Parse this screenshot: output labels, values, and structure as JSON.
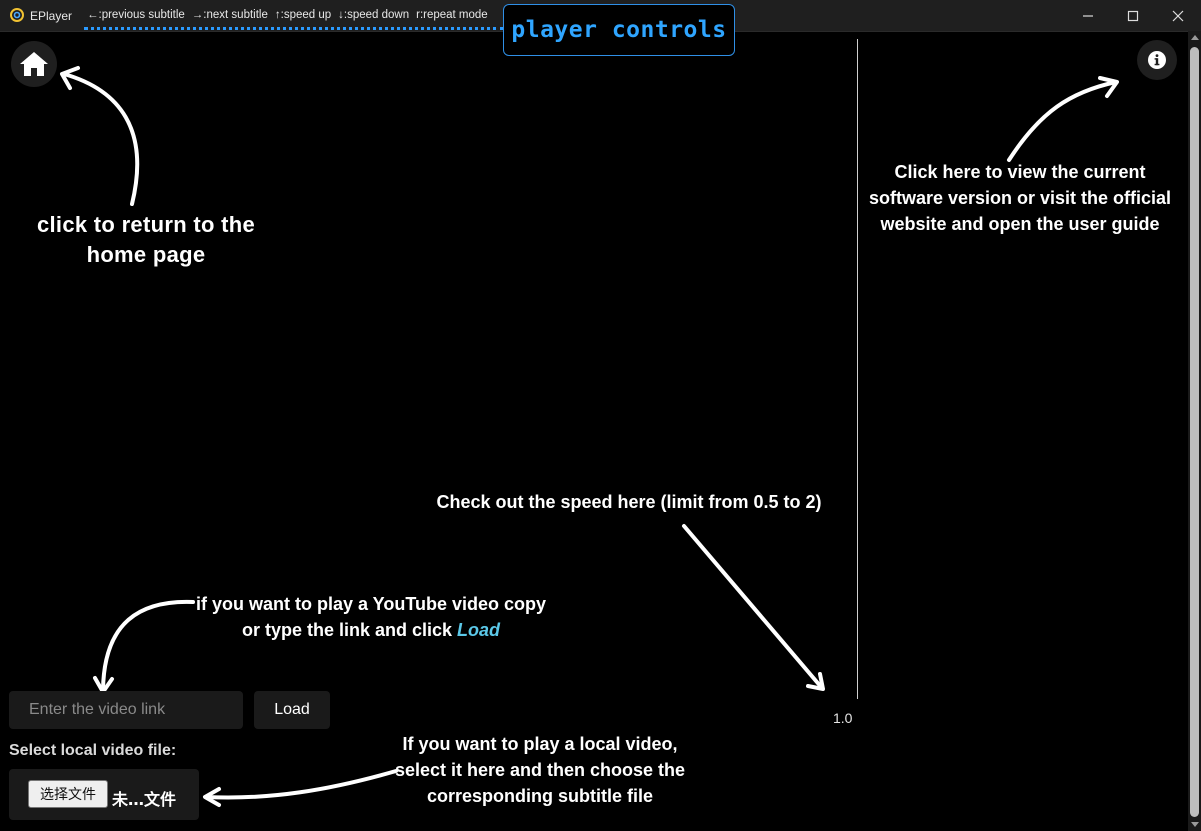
{
  "window": {
    "title": "EPlayer",
    "shortcuts": [
      "←:previous subtitle",
      "→:next subtitle",
      "↑:speed up",
      "↓:speed down",
      "r:repeat mode"
    ],
    "buttons": [
      "minimize-icon",
      "maximize-icon",
      "close-icon"
    ]
  },
  "controls_badge": {
    "label": "player controls",
    "color": "#2fa5ff"
  },
  "home_button": {
    "icon": "home-icon"
  },
  "info_button": {
    "icon": "info-icon"
  },
  "annotations": {
    "home": "click to return to the home page",
    "info": "Click here to view the current software version or visit the official website and open the user guide",
    "speed": "Check out the speed here (limit from 0.5 to 2)",
    "youtube_prefix": "if you want to play a YouTube video copy or type the link and click",
    "youtube_load": "Load",
    "local": "If you want to play a local video, select it here and then choose the corresponding subtitle file"
  },
  "speed": {
    "value": "1.0",
    "min": 0.5,
    "max": 2
  },
  "video_link": {
    "placeholder": "Enter the video link",
    "value": ""
  },
  "load_button": {
    "label": "Load"
  },
  "local_file": {
    "label": "Select local video file:",
    "choose_label": "选择文件",
    "status": "未…文件"
  },
  "colors": {
    "accent": "#2fa5ff",
    "load_word": "#5bc8e8",
    "background": "#000000"
  }
}
